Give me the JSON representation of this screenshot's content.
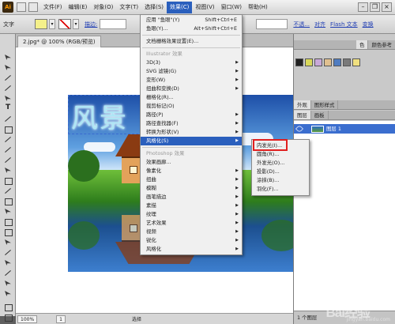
{
  "menubar": {
    "app_logo": "Ai",
    "items": [
      {
        "label": "文件(F)"
      },
      {
        "label": "编辑(E)"
      },
      {
        "label": "对象(O)"
      },
      {
        "label": "文字(T)"
      },
      {
        "label": "选择(S)"
      },
      {
        "label": "效果(C)"
      },
      {
        "label": "视图(V)"
      },
      {
        "label": "窗口(W)"
      },
      {
        "label": "帮助(H)"
      }
    ],
    "active_item": "效果(C)"
  },
  "control_bar": {
    "label": "文字",
    "stroke_label": "描边:",
    "opacity_label": "不透...",
    "links": [
      "对齐",
      "Flash 文本",
      "变换"
    ],
    "fill_color": "#f4f08a",
    "stroke_color": "#ffffff"
  },
  "document": {
    "tab_label": "2.jpg* @ 100% (RGB/预览)",
    "canvas_text": "风景"
  },
  "effects_menu": {
    "items": [
      {
        "label": "应用 \"鱼眼\"(Y)",
        "shortcut": "Shift+Ctrl+E"
      },
      {
        "label": "鱼眼(Y)...",
        "shortcut": "Alt+Shift+Ctrl+E"
      },
      {
        "sep": true
      },
      {
        "label": "文档栅格效果设置(E)..."
      },
      {
        "sep": true
      },
      {
        "header": "Illustrator 效果"
      },
      {
        "label": "3D(3)",
        "submenu": true
      },
      {
        "label": "SVG 滤镜(G)",
        "submenu": true
      },
      {
        "label": "变形(W)",
        "submenu": true
      },
      {
        "label": "扭曲和变换(D)",
        "submenu": true
      },
      {
        "label": "栅格化(R)..."
      },
      {
        "label": "裁剪标记(O)"
      },
      {
        "label": "路径(P)",
        "submenu": true
      },
      {
        "label": "路径查找器(F)",
        "submenu": true
      },
      {
        "label": "转换为形状(V)",
        "submenu": true
      },
      {
        "label": "风格化(S)",
        "submenu": true,
        "highlighted": true
      },
      {
        "sep": true
      },
      {
        "header": "Photoshop 效果"
      },
      {
        "label": "效果画廊..."
      },
      {
        "label": "像素化",
        "submenu": true
      },
      {
        "label": "扭曲",
        "submenu": true
      },
      {
        "label": "模糊",
        "submenu": true
      },
      {
        "label": "画笔描边",
        "submenu": true
      },
      {
        "label": "素描",
        "submenu": true
      },
      {
        "label": "纹理",
        "submenu": true
      },
      {
        "label": "艺术效果",
        "submenu": true
      },
      {
        "label": "视频",
        "submenu": true
      },
      {
        "label": "锐化",
        "submenu": true
      },
      {
        "label": "风格化",
        "submenu": true
      }
    ]
  },
  "stylize_menu": {
    "items": [
      {
        "label": "内发光(I)..."
      },
      {
        "label": "圆角(R)..."
      },
      {
        "label": "外发光(O)..."
      },
      {
        "label": "投影(D)..."
      },
      {
        "label": "涂抹(B)..."
      },
      {
        "label": "羽化(F)..."
      }
    ],
    "callout_color": "#e02020"
  },
  "right_panel": {
    "color_tabs": [
      "色",
      "颜色参考"
    ],
    "appearance_tabs": [
      "外观",
      "图形样式"
    ],
    "layers_tabs": [
      "图层",
      "画板"
    ],
    "layer": {
      "name": "图层 1"
    },
    "footer": "1 个图层"
  },
  "status_bar": {
    "zoom": "100%",
    "page": "1",
    "mode": "选择"
  },
  "watermark": {
    "text": "Bai经验",
    "sub": "jingyan.baidu.com"
  }
}
